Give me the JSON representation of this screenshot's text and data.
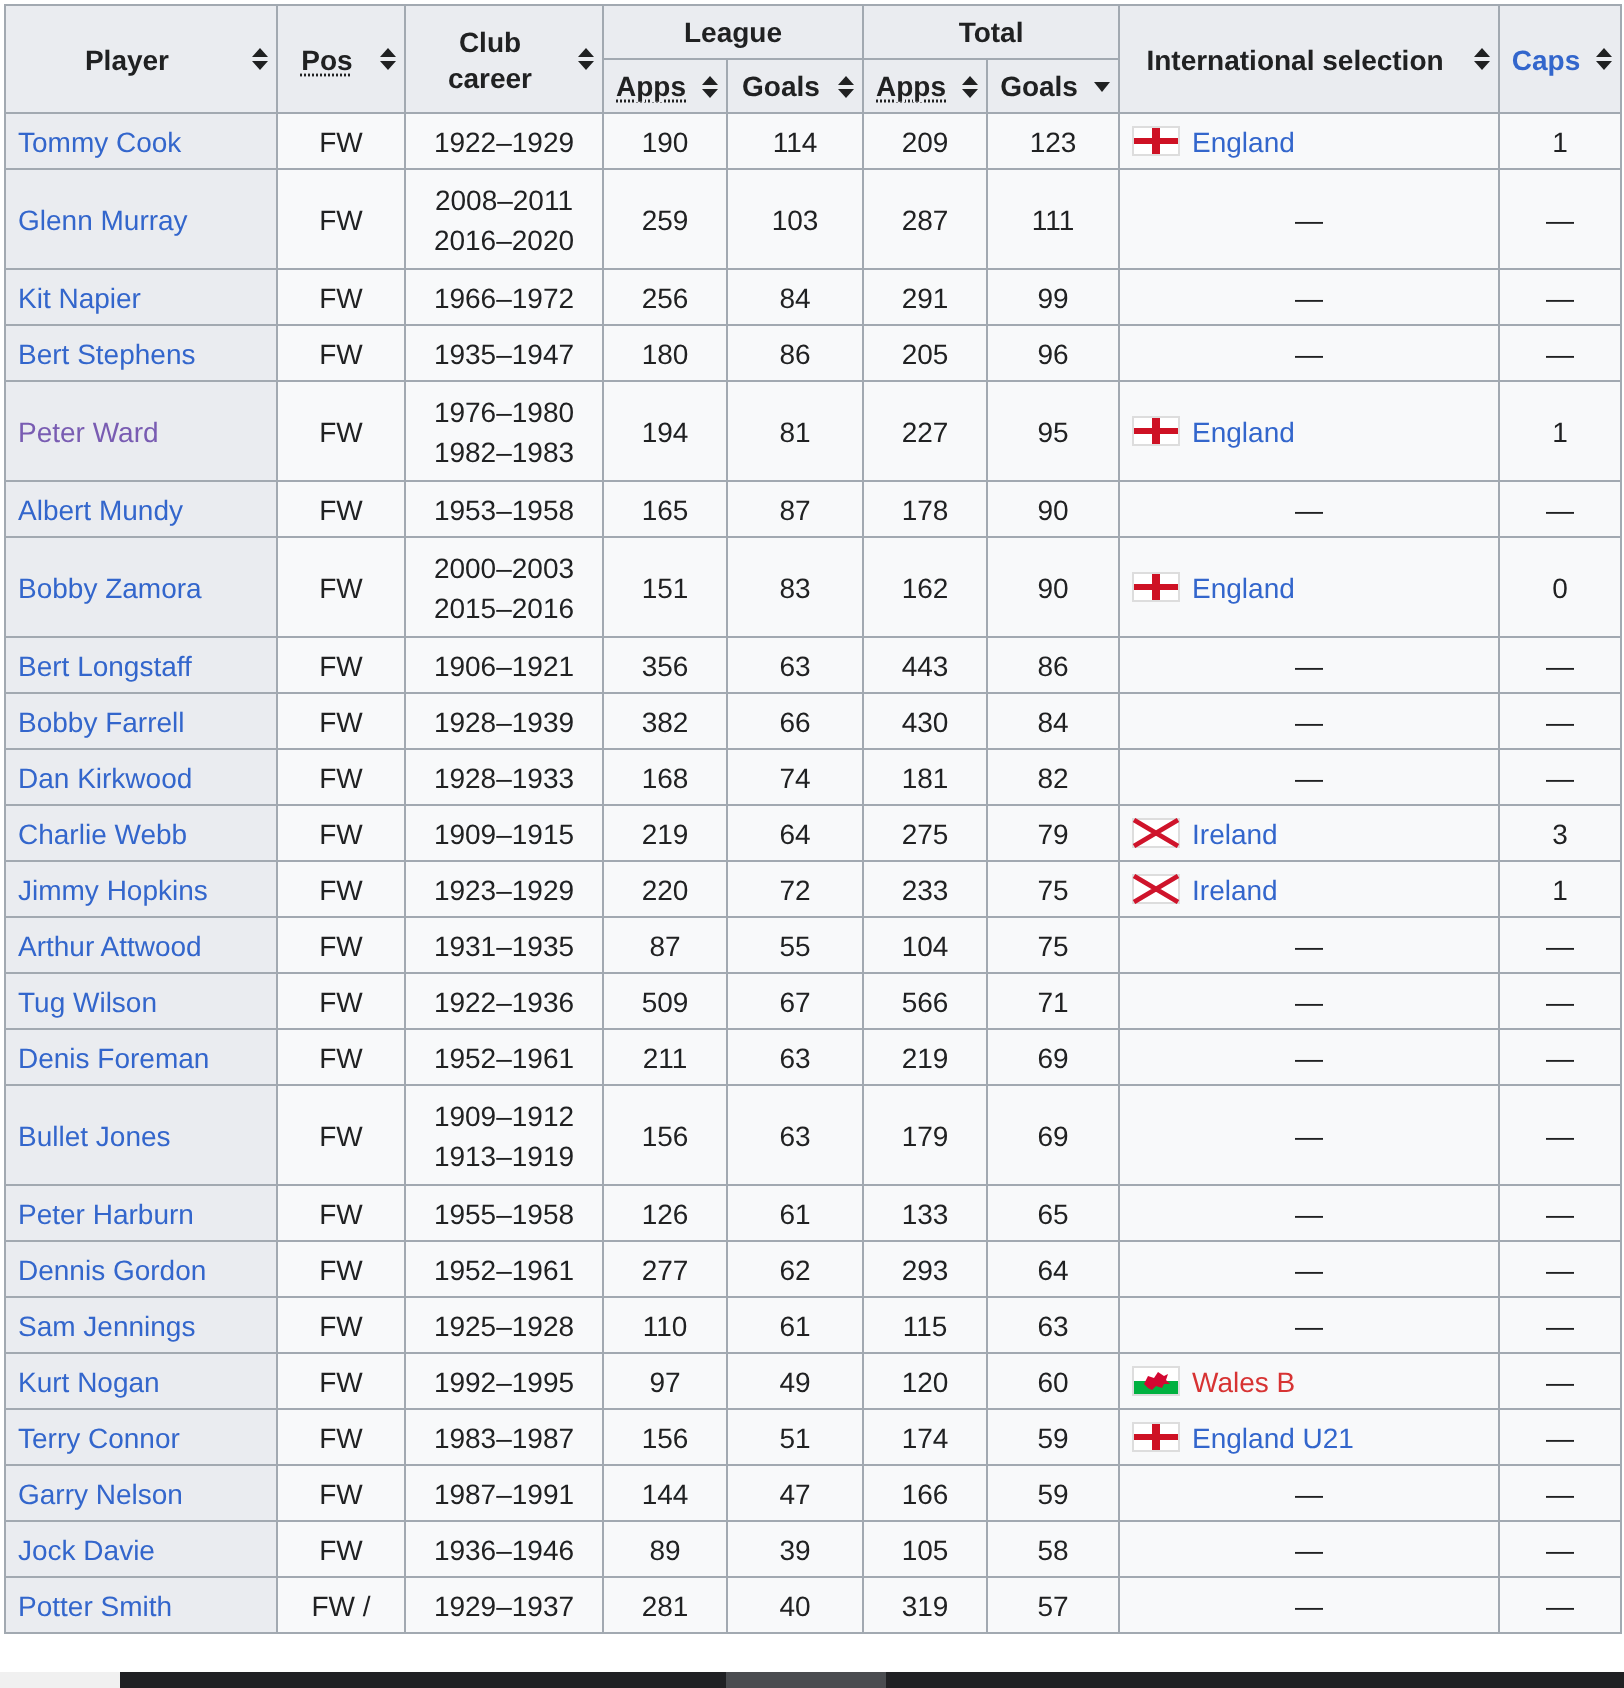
{
  "table": {
    "header": [
      {
        "label": "Player",
        "sorted_descending": false,
        "abbr": false,
        "link": false
      },
      {
        "label": "Pos",
        "sorted_descending": false,
        "abbr": true,
        "link": false
      },
      {
        "label": "Club career",
        "sorted_descending": false,
        "abbr": false,
        "link": false
      },
      {
        "label": "League",
        "children": [
          {
            "label": "Apps",
            "sorted_descending": false,
            "abbr": true,
            "link": false
          },
          {
            "label": "Goals",
            "sorted_descending": false,
            "abbr": false,
            "link": false
          }
        ]
      },
      {
        "label": "Total",
        "children": [
          {
            "label": "Apps",
            "sorted_descending": false,
            "abbr": true,
            "link": false
          },
          {
            "label": "Goals",
            "sorted_descending": true,
            "abbr": false,
            "link": false
          }
        ]
      },
      {
        "label": "International selection",
        "sorted_descending": false,
        "abbr": false,
        "link": false
      },
      {
        "label": "Caps",
        "sorted_descending": false,
        "abbr": false,
        "link": true
      }
    ],
    "rows": [
      {
        "player": {
          "text": "Tommy Cook",
          "visited": false
        },
        "pos": "FW",
        "club_career": [
          "1922–1929"
        ],
        "league_apps": "190",
        "league_goals": "114",
        "total_apps": "209",
        "total_goals": "123",
        "international": {
          "kind": "england",
          "text": "England",
          "page_missing": false
        },
        "caps": "1"
      },
      {
        "player": {
          "text": "Glenn Murray",
          "visited": false
        },
        "pos": "FW",
        "club_career": [
          "2008–2011",
          "2016–2020"
        ],
        "league_apps": "259",
        "league_goals": "103",
        "total_apps": "287",
        "total_goals": "111",
        "international": {
          "text": "—"
        },
        "caps": "—"
      },
      {
        "player": {
          "text": "Kit Napier",
          "visited": false
        },
        "pos": "FW",
        "club_career": [
          "1966–1972"
        ],
        "league_apps": "256",
        "league_goals": "84",
        "total_apps": "291",
        "total_goals": "99",
        "international": {
          "text": "—"
        },
        "caps": "—"
      },
      {
        "player": {
          "text": "Bert Stephens",
          "visited": false
        },
        "pos": "FW",
        "club_career": [
          "1935–1947"
        ],
        "league_apps": "180",
        "league_goals": "86",
        "total_apps": "205",
        "total_goals": "96",
        "international": {
          "text": "—"
        },
        "caps": "—"
      },
      {
        "player": {
          "text": "Peter Ward",
          "visited": true
        },
        "pos": "FW",
        "club_career": [
          "1976–1980",
          "1982–1983"
        ],
        "league_apps": "194",
        "league_goals": "81",
        "total_apps": "227",
        "total_goals": "95",
        "international": {
          "kind": "england",
          "text": "England",
          "page_missing": false
        },
        "caps": "1"
      },
      {
        "player": {
          "text": "Albert Mundy",
          "visited": false
        },
        "pos": "FW",
        "club_career": [
          "1953–1958"
        ],
        "league_apps": "165",
        "league_goals": "87",
        "total_apps": "178",
        "total_goals": "90",
        "international": {
          "text": "—"
        },
        "caps": "—"
      },
      {
        "player": {
          "text": "Bobby Zamora",
          "visited": false
        },
        "pos": "FW",
        "club_career": [
          "2000–2003",
          "2015–2016"
        ],
        "league_apps": "151",
        "league_goals": "83",
        "total_apps": "162",
        "total_goals": "90",
        "international": {
          "kind": "england",
          "text": "England",
          "page_missing": false
        },
        "caps": "0"
      },
      {
        "player": {
          "text": "Bert Longstaff",
          "visited": false
        },
        "pos": "FW",
        "club_career": [
          "1906–1921"
        ],
        "league_apps": "356",
        "league_goals": "63",
        "total_apps": "443",
        "total_goals": "86",
        "international": {
          "text": "—"
        },
        "caps": "—"
      },
      {
        "player": {
          "text": "Bobby Farrell",
          "visited": false
        },
        "pos": "FW",
        "club_career": [
          "1928–1939"
        ],
        "league_apps": "382",
        "league_goals": "66",
        "total_apps": "430",
        "total_goals": "84",
        "international": {
          "text": "—"
        },
        "caps": "—"
      },
      {
        "player": {
          "text": "Dan Kirkwood",
          "visited": false
        },
        "pos": "FW",
        "club_career": [
          "1928–1933"
        ],
        "league_apps": "168",
        "league_goals": "74",
        "total_apps": "181",
        "total_goals": "82",
        "international": {
          "text": "—"
        },
        "caps": "—"
      },
      {
        "player": {
          "text": "Charlie Webb",
          "visited": false
        },
        "pos": "FW",
        "club_career": [
          "1909–1915"
        ],
        "league_apps": "219",
        "league_goals": "64",
        "total_apps": "275",
        "total_goals": "79",
        "international": {
          "kind": "ireland",
          "text": "Ireland",
          "page_missing": false
        },
        "caps": "3"
      },
      {
        "player": {
          "text": "Jimmy Hopkins",
          "visited": false
        },
        "pos": "FW",
        "club_career": [
          "1923–1929"
        ],
        "league_apps": "220",
        "league_goals": "72",
        "total_apps": "233",
        "total_goals": "75",
        "international": {
          "kind": "ireland",
          "text": "Ireland",
          "page_missing": false
        },
        "caps": "1"
      },
      {
        "player": {
          "text": "Arthur Attwood",
          "visited": false
        },
        "pos": "FW",
        "club_career": [
          "1931–1935"
        ],
        "league_apps": "87",
        "league_goals": "55",
        "total_apps": "104",
        "total_goals": "75",
        "international": {
          "text": "—"
        },
        "caps": "—"
      },
      {
        "player": {
          "text": "Tug Wilson",
          "visited": false
        },
        "pos": "FW",
        "club_career": [
          "1922–1936"
        ],
        "league_apps": "509",
        "league_goals": "67",
        "total_apps": "566",
        "total_goals": "71",
        "international": {
          "text": "—"
        },
        "caps": "—"
      },
      {
        "player": {
          "text": "Denis Foreman",
          "visited": false
        },
        "pos": "FW",
        "club_career": [
          "1952–1961"
        ],
        "league_apps": "211",
        "league_goals": "63",
        "total_apps": "219",
        "total_goals": "69",
        "international": {
          "text": "—"
        },
        "caps": "—"
      },
      {
        "player": {
          "text": "Bullet Jones",
          "visited": false
        },
        "pos": "FW",
        "club_career": [
          "1909–1912",
          "1913–1919"
        ],
        "league_apps": "156",
        "league_goals": "63",
        "total_apps": "179",
        "total_goals": "69",
        "international": {
          "text": "—"
        },
        "caps": "—"
      },
      {
        "player": {
          "text": "Peter Harburn",
          "visited": false
        },
        "pos": "FW",
        "club_career": [
          "1955–1958"
        ],
        "league_apps": "126",
        "league_goals": "61",
        "total_apps": "133",
        "total_goals": "65",
        "international": {
          "text": "—"
        },
        "caps": "—"
      },
      {
        "player": {
          "text": "Dennis Gordon",
          "visited": false
        },
        "pos": "FW",
        "club_career": [
          "1952–1961"
        ],
        "league_apps": "277",
        "league_goals": "62",
        "total_apps": "293",
        "total_goals": "64",
        "international": {
          "text": "—"
        },
        "caps": "—"
      },
      {
        "player": {
          "text": "Sam Jennings",
          "visited": false
        },
        "pos": "FW",
        "club_career": [
          "1925–1928"
        ],
        "league_apps": "110",
        "league_goals": "61",
        "total_apps": "115",
        "total_goals": "63",
        "international": {
          "text": "—"
        },
        "caps": "—"
      },
      {
        "player": {
          "text": "Kurt Nogan",
          "visited": false
        },
        "pos": "FW",
        "club_career": [
          "1992–1995"
        ],
        "league_apps": "97",
        "league_goals": "49",
        "total_apps": "120",
        "total_goals": "60",
        "international": {
          "kind": "wales",
          "text": "Wales B",
          "page_missing": true
        },
        "caps": "—"
      },
      {
        "player": {
          "text": "Terry Connor",
          "visited": false
        },
        "pos": "FW",
        "club_career": [
          "1983–1987"
        ],
        "league_apps": "156",
        "league_goals": "51",
        "total_apps": "174",
        "total_goals": "59",
        "international": {
          "kind": "england",
          "text": "England U21",
          "page_missing": false
        },
        "caps": "—"
      },
      {
        "player": {
          "text": "Garry Nelson",
          "visited": false
        },
        "pos": "FW",
        "club_career": [
          "1987–1991"
        ],
        "league_apps": "144",
        "league_goals": "47",
        "total_apps": "166",
        "total_goals": "59",
        "international": {
          "text": "—"
        },
        "caps": "—"
      },
      {
        "player": {
          "text": "Jock Davie",
          "visited": false
        },
        "pos": "FW",
        "club_career": [
          "1936–1946"
        ],
        "league_apps": "89",
        "league_goals": "39",
        "total_apps": "105",
        "total_goals": "58",
        "international": {
          "text": "—"
        },
        "caps": "—"
      },
      {
        "player": {
          "text": "Potter Smith",
          "visited": false
        },
        "pos": "FW /",
        "club_career": [
          "1929–1937"
        ],
        "league_apps": "281",
        "league_goals": "40",
        "total_apps": "319",
        "total_goals": "57",
        "international": {
          "text": "—"
        },
        "caps": "—"
      }
    ]
  }
}
